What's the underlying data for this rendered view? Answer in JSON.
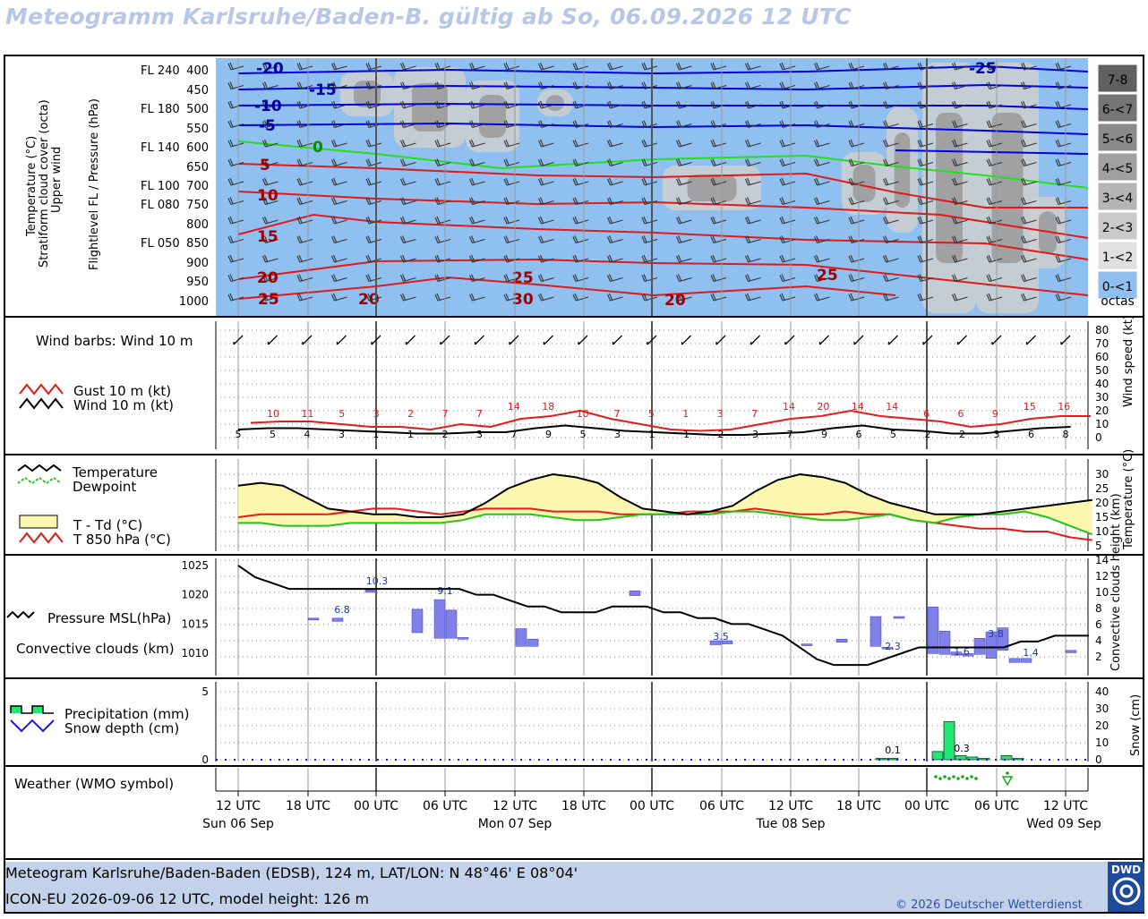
{
  "title": "Meteogramm Karlsruhe/Baden-B. gültig ab So, 06.09.2026 12 UTC",
  "colors": {
    "sky": "#8fc0f0",
    "panel_bg": "#ffffff",
    "temp_fill": "#fbf7b0",
    "temp_line": "#000000",
    "dewpoint_line": "#22c41a",
    "t850_line": "#e61a1a",
    "gust_line": "#e61a1a",
    "wind_line": "#000000",
    "pressure_line": "#000000",
    "conv_bar": "#7f80e8",
    "precip_bar": "#22e672",
    "snow_line": "#1a1ae6",
    "footer_bg": "#c3d1ea"
  },
  "upper_panel": {
    "ylabel_lines": [
      "Temperature (°C)",
      "Stratiform cloud cover (octa)",
      "Upper wind",
      "Flightlevel FL / Pressure (hPa)"
    ],
    "levels": [
      {
        "fl": "FL 240",
        "hpa": "400"
      },
      {
        "fl": "",
        "hpa": "450"
      },
      {
        "fl": "FL 180",
        "hpa": "500"
      },
      {
        "fl": "",
        "hpa": "550"
      },
      {
        "fl": "FL 140",
        "hpa": "600"
      },
      {
        "fl": "",
        "hpa": "650"
      },
      {
        "fl": "FL 100",
        "hpa": "700"
      },
      {
        "fl": "FL 080",
        "hpa": "750"
      },
      {
        "fl": "",
        "hpa": "800"
      },
      {
        "fl": "FL 050",
        "hpa": "850"
      },
      {
        "fl": "",
        "hpa": "900"
      },
      {
        "fl": "",
        "hpa": "950"
      },
      {
        "fl": "",
        "hpa": "1000"
      }
    ],
    "cloud_legend": [
      "7-8",
      "6-<7",
      "5-<6",
      "4-<5",
      "3-<4",
      "2-<3",
      "1-<2",
      "0-<1",
      "octas"
    ],
    "isotherm_labels": [
      "-20",
      "-15",
      "-10",
      "-5",
      "0",
      "5",
      "10",
      "15",
      "20",
      "25",
      "20",
      "25",
      "30",
      "20",
      "25",
      "-25"
    ]
  },
  "chart_data": [
    {
      "type": "line",
      "title": "Wind barbs: Wind 10 m",
      "ylabel": "Wind speed (kt)",
      "ylim": [
        0,
        80
      ],
      "yticks": [
        0,
        10,
        20,
        30,
        40,
        50,
        60,
        70,
        80
      ],
      "series": [
        {
          "name": "Gust 10 m (kt)",
          "labels": [
            10,
            11,
            5,
            3,
            2,
            7,
            7,
            14,
            18,
            10,
            7,
            5,
            1,
            3,
            7,
            14,
            20,
            14,
            14,
            6,
            6,
            9,
            15,
            16
          ]
        },
        {
          "name": "Wind 10 m (kt)",
          "labels": [
            5,
            5,
            4,
            3,
            1,
            1,
            2,
            3,
            7,
            9,
            5,
            3,
            1,
            1,
            2,
            3,
            7,
            9,
            6,
            5,
            2,
            2,
            3,
            6,
            8
          ]
        }
      ]
    },
    {
      "type": "area",
      "ylabel": "Temperature (°C)",
      "ylim": [
        5,
        35
      ],
      "yticks": [
        5,
        10,
        15,
        20,
        25,
        30
      ],
      "series": [
        {
          "name": "Temperature"
        },
        {
          "name": "Dewpoint"
        },
        {
          "name": "T - Td (°C)"
        },
        {
          "name": "T 850 hPa (°C)"
        }
      ]
    },
    {
      "type": "bar",
      "ylabel_left": "Pressure MSL(hPa)",
      "ylabel_right": "Convective clouds height (km)",
      "pressure_ticks": [
        1010,
        1015,
        1020,
        1025
      ],
      "km_ticks": [
        2,
        4,
        6,
        8,
        10,
        12,
        14
      ],
      "labels": [
        "6.8",
        "10.3",
        "9.1",
        "3.5",
        "2.3",
        "1.6",
        "3.8",
        "1.4"
      ],
      "series": [
        {
          "name": "Pressure MSL(hPa)"
        },
        {
          "name": "Convective clouds (km)"
        }
      ]
    },
    {
      "type": "bar",
      "ylabel": "Snow (cm)",
      "ylim_mm": [
        0,
        5
      ],
      "mm_ticks": [
        0,
        5
      ],
      "cm_ticks": [
        0,
        10,
        20,
        30,
        40
      ],
      "labels": [
        "0.1",
        "0.3"
      ],
      "series": [
        {
          "name": "Precipitation (mm)"
        },
        {
          "name": "Snow depth (cm)"
        }
      ]
    }
  ],
  "legend": {
    "wind_barbs": "Wind barbs: Wind 10 m",
    "gust": "Gust 10 m (kt)",
    "wind": "Wind 10 m (kt)",
    "temperature": "Temperature",
    "dewpoint": "Dewpoint",
    "t_td": "T - Td (°C)",
    "t850": "T 850 hPa (°C)",
    "pressure": "Pressure MSL(hPa)",
    "convective": "Convective clouds (km)",
    "precip": "Precipitation (mm)",
    "snow": "Snow depth (cm)",
    "weather": "Weather (WMO symbol)"
  },
  "right_labels": {
    "wind": "Wind speed (kt)",
    "temp": "Temperature (°C)",
    "conv": "Convective clouds height (km)",
    "snow": "Snow (cm)"
  },
  "time_axis": {
    "ticks": [
      "12 UTC",
      "18 UTC",
      "00 UTC",
      "06 UTC",
      "12 UTC",
      "18 UTC",
      "00 UTC",
      "06 UTC",
      "12 UTC",
      "18 UTC",
      "00 UTC",
      "06 UTC",
      "12 UTC"
    ],
    "days": [
      "Sun 06 Sep",
      "Mon 07 Sep",
      "Tue 08 Sep",
      "Wed 09 Sep"
    ]
  },
  "footer": {
    "line1": "Meteogram Karlsruhe/Baden-Baden (EDSB), 124 m, LAT/LON: N 48°46' E 08°04'",
    "line2": "ICON-EU 2026-09-06 12 UTC, model height: 126 m",
    "copyright": "© 2026 Deutscher Wetterdienst",
    "logo": "DWD"
  }
}
